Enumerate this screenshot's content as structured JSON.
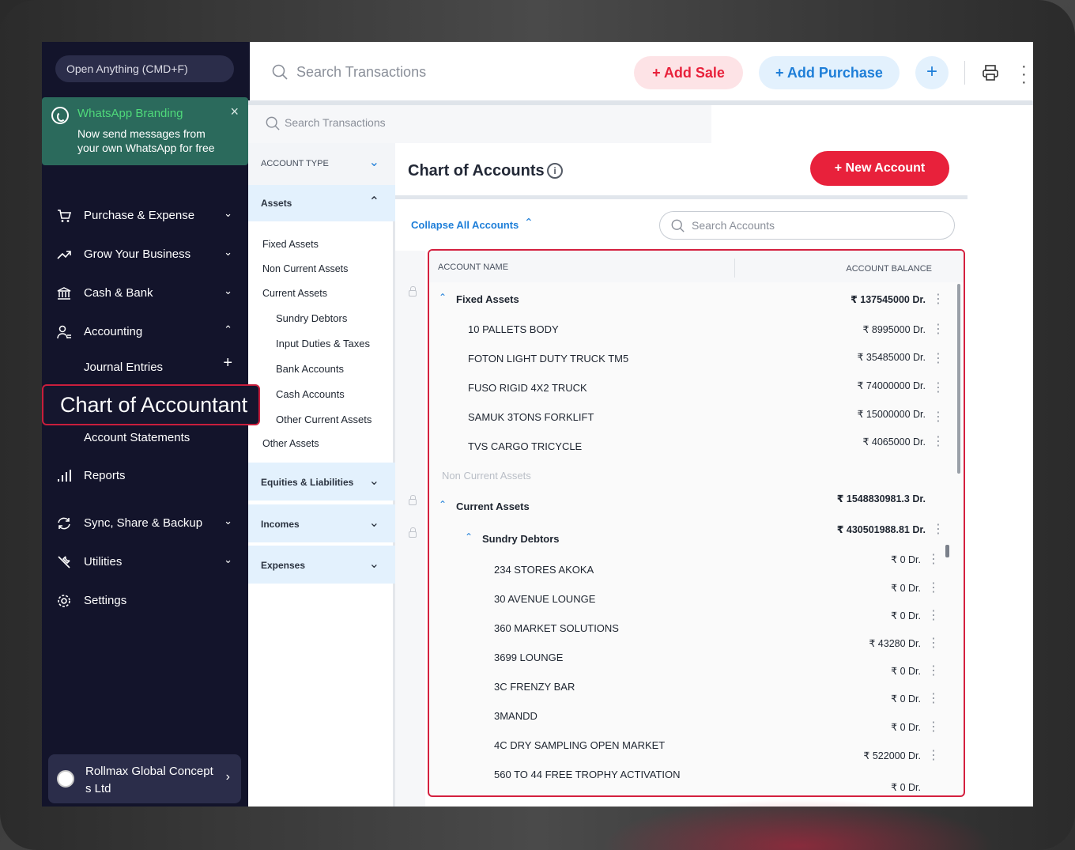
{
  "sidebar": {
    "open_anything": "Open Anything (CMD+F)",
    "whatsapp": {
      "title": "WhatsApp Branding",
      "text": "Now send messages from your own WhatsApp for free",
      "close": "×"
    },
    "items": [
      {
        "label": "Purchase & Expense",
        "icon": "cart-icon"
      },
      {
        "label": "Grow Your Business",
        "icon": "trend-icon"
      },
      {
        "label": "Cash & Bank",
        "icon": "bank-icon"
      },
      {
        "label": "Accounting",
        "icon": "user-icon"
      },
      {
        "label": "Reports",
        "icon": "bar-chart-icon"
      },
      {
        "label": "Sync, Share & Backup",
        "icon": "sync-icon"
      },
      {
        "label": "Utilities",
        "icon": "tools-icon"
      },
      {
        "label": "Settings",
        "icon": "gear-icon"
      }
    ],
    "accounting_sub": {
      "journal": "Journal Entries",
      "chart": "Chart of Accountant",
      "statements": "Account Statements"
    },
    "company": "Rollmax Global Concept s Ltd"
  },
  "topbar": {
    "search_placeholder": "Search Transactions",
    "add_sale": "+ Add Sale",
    "add_purchase": "+ Add Purchase",
    "plus": "+"
  },
  "secondary_search": "Search Transactions",
  "filters": {
    "account_type": "ACCOUNT TYPE",
    "assets": "Assets",
    "asset_items": [
      "Fixed Assets",
      "Non Current Assets",
      "Current Assets"
    ],
    "current_sub": [
      "Sundry Debtors",
      "Input Duties & Taxes",
      "Bank Accounts",
      "Cash Accounts",
      "Other Current Assets"
    ],
    "other_assets": "Other Assets",
    "equities": "Equities & Liabilities",
    "incomes": "Incomes",
    "expenses": "Expenses"
  },
  "main": {
    "title": "Chart of Accounts",
    "new_account": "+ New Account",
    "collapse": "Collapse All Accounts",
    "search_accounts": "Search Accounts",
    "col_name": "ACCOUNT NAME",
    "col_balance": "ACCOUNT BALANCE"
  },
  "rows": [
    {
      "name": "Fixed Assets",
      "bal": "₹ 137545000 Dr."
    },
    {
      "name": "10 PALLETS BODY",
      "bal": "₹ 8995000 Dr."
    },
    {
      "name": "FOTON LIGHT DUTY TRUCK TM5",
      "bal": "₹ 35485000 Dr."
    },
    {
      "name": "FUSO RIGID 4X2 TRUCK",
      "bal": "₹ 74000000 Dr."
    },
    {
      "name": "SAMUK 3TONS FORKLIFT",
      "bal": "₹ 15000000 Dr."
    },
    {
      "name": "TVS CARGO TRICYCLE",
      "bal": "₹ 4065000 Dr."
    },
    {
      "name": "Non Current Assets",
      "bal": ""
    },
    {
      "name": "Current Assets",
      "bal": "₹ 1548830981.3 Dr."
    },
    {
      "name": "Sundry Debtors",
      "bal": "₹ 430501988.81 Dr."
    },
    {
      "name": "234 STORES AKOKA",
      "bal": "₹ 0 Dr."
    },
    {
      "name": "30 AVENUE LOUNGE",
      "bal": "₹ 0 Dr."
    },
    {
      "name": "360 MARKET SOLUTIONS",
      "bal": "₹ 0 Dr."
    },
    {
      "name": "3699 LOUNGE",
      "bal": "₹ 43280 Dr."
    },
    {
      "name": "3C FRENZY BAR",
      "bal": "₹ 0 Dr."
    },
    {
      "name": "3MANDD",
      "bal": "₹ 0 Dr."
    },
    {
      "name": "4C DRY SAMPLING OPEN MARKET",
      "bal": "₹ 0 Dr."
    },
    {
      "name": "560 TO 44 FREE TROPHY ACTIVATION",
      "bal": "₹ 522000 Dr."
    },
    {
      "name": "",
      "bal": "₹ 0 Dr."
    }
  ]
}
